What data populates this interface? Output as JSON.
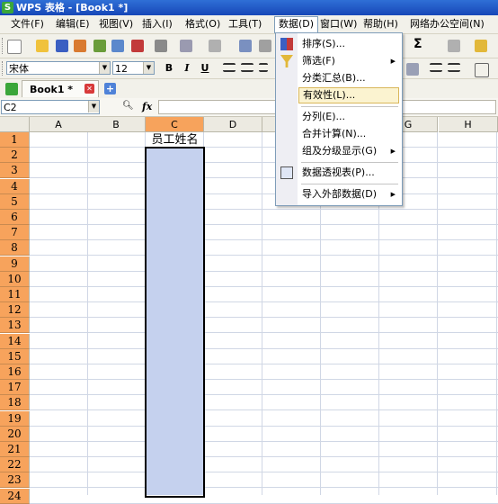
{
  "window": {
    "title": "WPS 表格 - [Book1 *]",
    "logo_letter": "S"
  },
  "menubar": [
    "文件(F)",
    "编辑(E)",
    "视图(V)",
    "插入(I)",
    "格式(O)",
    "工具(T)",
    "数据(D)",
    "窗口(W)",
    "帮助(H)",
    "网络办公空间(N)"
  ],
  "menubar_active": "数据(D)",
  "font": {
    "name": "宋体",
    "size": "12",
    "bold": "B",
    "italic": "I",
    "underline": "U"
  },
  "toolbar": {
    "sum_symbol": "Σ"
  },
  "tabs": [
    {
      "label": "Book1 *"
    }
  ],
  "namebox": {
    "value": "C2",
    "fx": "fx"
  },
  "columns": [
    "A",
    "B",
    "C",
    "D",
    "E",
    "F",
    "G",
    "H"
  ],
  "selected_column": "C",
  "rows": [
    "1",
    "2",
    "3",
    "4",
    "5",
    "6",
    "7",
    "8",
    "9",
    "10",
    "11",
    "12",
    "13",
    "14",
    "15",
    "16",
    "17",
    "18",
    "19",
    "20",
    "21",
    "22",
    "23",
    "24"
  ],
  "cells": {
    "C1": "员工姓名"
  },
  "dropdown": {
    "items": [
      {
        "label": "排序(S)...",
        "icon": "sort-icon",
        "arrow": false
      },
      {
        "label": "筛选(F)",
        "icon": "filter-icon",
        "arrow": true
      },
      {
        "label": "分类汇总(B)...",
        "icon": "",
        "arrow": false
      },
      {
        "label": "有效性(L)...",
        "icon": "",
        "arrow": false,
        "highlighted": true
      },
      {
        "label": "分列(E)...",
        "icon": "",
        "arrow": false,
        "separator_before": true
      },
      {
        "label": "合并计算(N)...",
        "icon": "",
        "arrow": false
      },
      {
        "label": "组及分级显示(G)",
        "icon": "",
        "arrow": true
      },
      {
        "label": "数据透视表(P)...",
        "icon": "pivot-table-icon",
        "arrow": false,
        "separator_before": true
      },
      {
        "label": "导入外部数据(D)",
        "icon": "",
        "arrow": true,
        "separator_before": true
      }
    ]
  },
  "colors": {
    "selection_fill": "#c5d1ee",
    "header_selected": "#f7a35c",
    "title_bar": "#1f57c8"
  }
}
